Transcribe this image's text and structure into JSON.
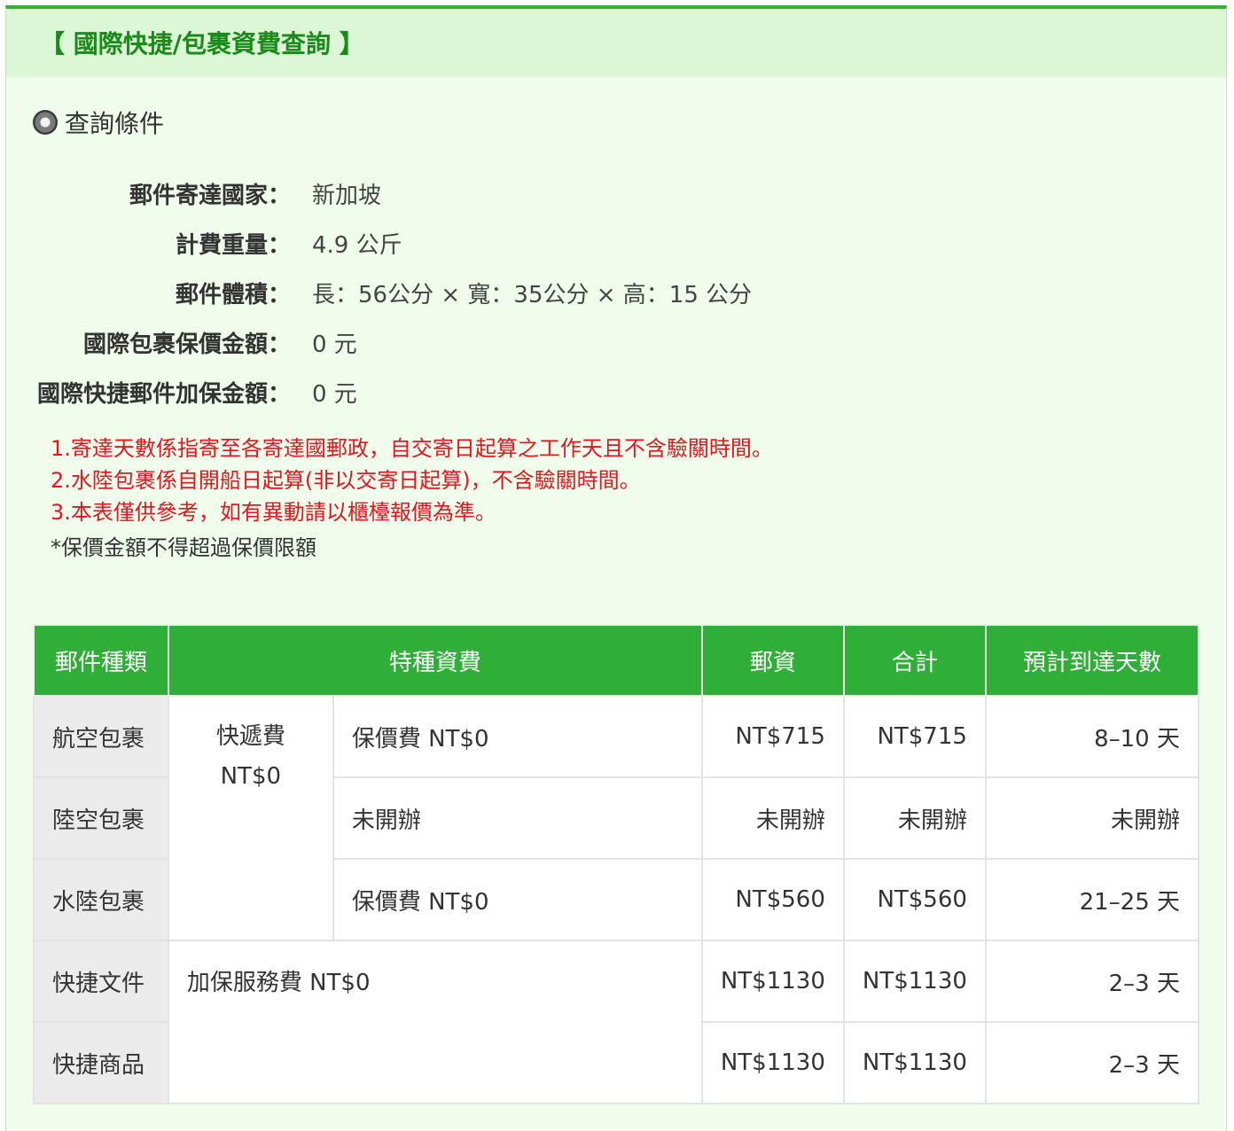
{
  "header": {
    "title": "【 國際快捷/包裹資費查詢 】"
  },
  "section": {
    "title": "查詢條件",
    "icon": "radio-bullet-icon"
  },
  "conditions": [
    {
      "label": "郵件寄達國家：",
      "value": "新加坡"
    },
    {
      "label": "計費重量：",
      "value": "4.9 公斤"
    },
    {
      "label": "郵件體積：",
      "value": "長：56公分 × 寬：35公分 × 高：15 公分"
    },
    {
      "label": "國際包裹保價金額：",
      "value": "0 元"
    },
    {
      "label": "國際快捷郵件加保金額：",
      "value": "0 元"
    }
  ],
  "notes": {
    "red": [
      "1.寄達天數係指寄至各寄達國郵政，自交寄日起算之工作天且不含驗關時間。",
      "2.水陸包裹係自開船日起算(非以交寄日起算)，不含驗關時間。",
      "3.本表僅供參考，如有異動請以櫃檯報價為準。"
    ],
    "plain": "*保價金額不得超過保價限額"
  },
  "table": {
    "headers": [
      "郵件種類",
      "特種資費",
      "郵資",
      "合計",
      "預計到達天數"
    ],
    "express_fee_label": "快遞費",
    "express_fee_value": "NT$0",
    "insured_service_fee": "加保服務費 NT$0",
    "rows": [
      {
        "type": "航空包裹",
        "fee": "保價費 NT$0",
        "postage": "NT$715",
        "total": "NT$715",
        "days": "8–10 天"
      },
      {
        "type": "陸空包裹",
        "fee": "未開辦",
        "postage": "未開辦",
        "total": "未開辦",
        "days": "未開辦"
      },
      {
        "type": "水陸包裹",
        "fee": "保價費 NT$0",
        "postage": "NT$560",
        "total": "NT$560",
        "days": "21–25 天"
      },
      {
        "type": "快捷文件",
        "postage": "NT$1130",
        "total": "NT$1130",
        "days": "2–3 天"
      },
      {
        "type": "快捷商品",
        "postage": "NT$1130",
        "total": "NT$1130",
        "days": "2–3 天"
      }
    ]
  },
  "colors": {
    "accent": "#2fae38",
    "header_bg": "#dcf7d6",
    "panel_bg": "#f1fdec",
    "warning": "#e8141b"
  }
}
